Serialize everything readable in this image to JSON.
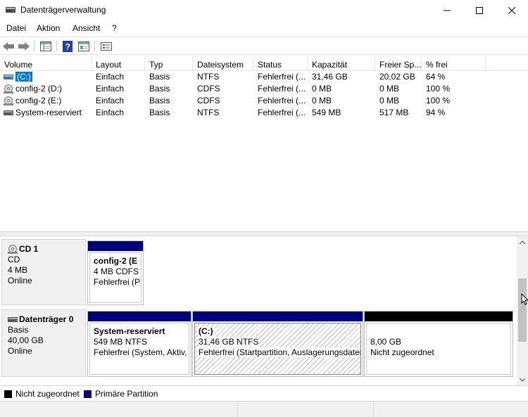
{
  "window": {
    "title": "Datenträgerverwaltung"
  },
  "menu": [
    "Datei",
    "Aktion",
    "Ansicht",
    "?"
  ],
  "toolbar": {
    "items": [
      "back-icon",
      "forward-icon",
      "list-view-icon",
      "help-icon",
      "properties-icon",
      "disk-view-icon"
    ]
  },
  "volumes": {
    "columns": [
      "Volume",
      "Layout",
      "Typ",
      "Dateisystem",
      "Status",
      "Kapazität",
      "Freier Sp...",
      "% frei"
    ],
    "rows": [
      {
        "name": "(C:)",
        "layout": "Einfach",
        "type": "Basis",
        "fs": "NTFS",
        "status": "Fehlerfrei (...",
        "capacity": "31,46 GB",
        "free": "20,02 GB",
        "pct": "64 %",
        "icon": "volume-icon"
      },
      {
        "name": "config-2 (D:)",
        "layout": "Einfach",
        "type": "Basis",
        "fs": "CDFS",
        "status": "Fehlerfrei (...",
        "capacity": "0 MB",
        "free": "0 MB",
        "pct": "100 %",
        "icon": "cd-icon"
      },
      {
        "name": "config-2 (E:)",
        "layout": "Einfach",
        "type": "Basis",
        "fs": "CDFS",
        "status": "Fehlerfrei (...",
        "capacity": "0 MB",
        "free": "0 MB",
        "pct": "100 %",
        "icon": "cd-icon"
      },
      {
        "name": "System-reserviert",
        "layout": "Einfach",
        "type": "Basis",
        "fs": "NTFS",
        "status": "Fehlerfrei (...",
        "capacity": "549 MB",
        "free": "517 MB",
        "pct": "94 %",
        "icon": "volume-icon"
      }
    ]
  },
  "disks": [
    {
      "name": "CD 1",
      "kind": "CD",
      "size": "4 MB",
      "state": "Online",
      "partitions": [
        {
          "name": "config-2  (E",
          "detail": "4 MB CDFS",
          "status": "Fehlerfrei (P"
        }
      ]
    },
    {
      "name": "Datenträger 0",
      "kind": "Basis",
      "size": "40,00 GB",
      "state": "Online",
      "partitions": [
        {
          "name": "System-reserviert",
          "detail": "549 MB NTFS",
          "status": "Fehlerfrei (System, Aktiv,"
        },
        {
          "name": "(C:)",
          "detail": "31,46 GB NTFS",
          "status": "Fehlerfrei (Startpartition, Auslagerungsdatei"
        },
        {
          "name": "",
          "detail": "8,00 GB",
          "status": "Nicht zugeordnet"
        }
      ]
    }
  ],
  "legend": [
    {
      "label": "Nicht zugeordnet",
      "color": "#000000"
    },
    {
      "label": "Primäre Partition",
      "color": "#000080"
    }
  ],
  "colors": {
    "primary_partition": "#000080",
    "unallocated": "#000000",
    "selection": "#0078d7"
  }
}
